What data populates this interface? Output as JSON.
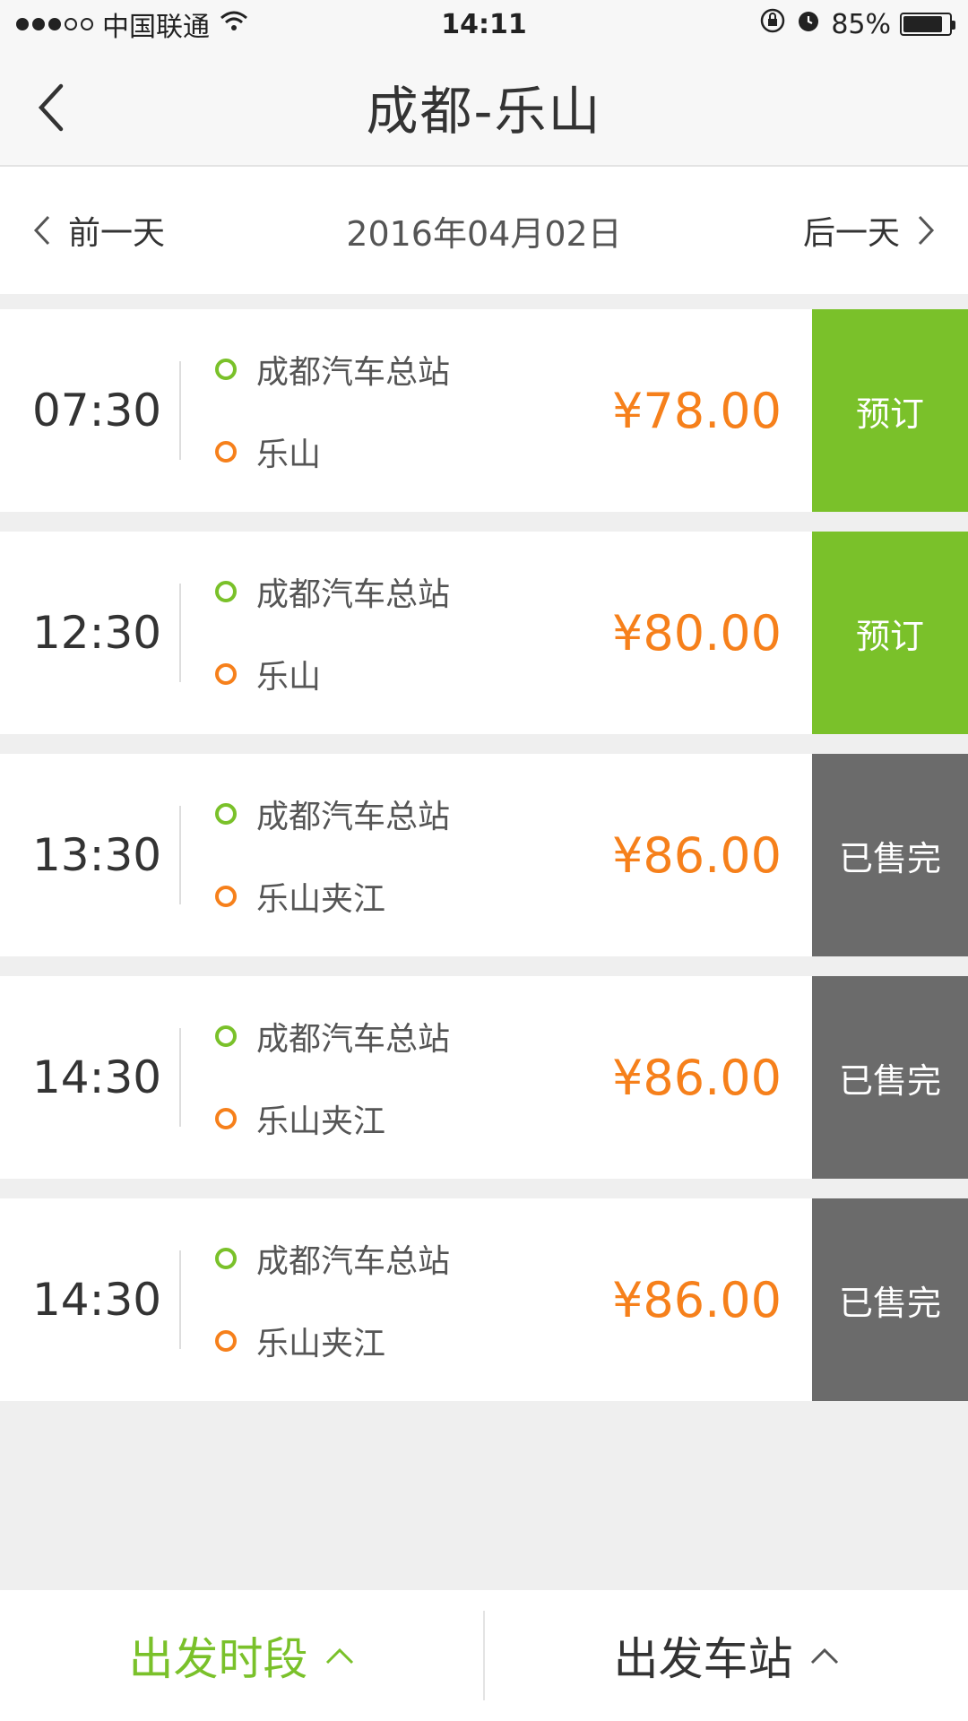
{
  "status_bar": {
    "carrier": "中国联通",
    "time": "14:11",
    "battery": "85%",
    "battery_level": 0.85
  },
  "nav": {
    "title": "成都-乐山"
  },
  "date_bar": {
    "prev_label": "前一天",
    "current_date": "2016年04月02日",
    "next_label": "后一天"
  },
  "trips": [
    {
      "time": "07:30",
      "from": "成都汽车总站",
      "to": "乐山",
      "price": "¥78.00",
      "action": "预订",
      "status": "book"
    },
    {
      "time": "12:30",
      "from": "成都汽车总站",
      "to": "乐山",
      "price": "¥80.00",
      "action": "预订",
      "status": "book"
    },
    {
      "time": "13:30",
      "from": "成都汽车总站",
      "to": "乐山夹江",
      "price": "¥86.00",
      "action": "已售完",
      "status": "soldout"
    },
    {
      "time": "14:30",
      "from": "成都汽车总站",
      "to": "乐山夹江",
      "price": "¥86.00",
      "action": "已售完",
      "status": "soldout"
    },
    {
      "time": "14:30",
      "from": "成都汽车总站",
      "to": "乐山夹江",
      "price": "¥86.00",
      "action": "已售完",
      "status": "soldout"
    }
  ],
  "bottom_tabs": {
    "departure_time": "出发时段",
    "departure_station": "出发车站"
  },
  "colors": {
    "green": "#7ac12a",
    "orange": "#f6801b",
    "soldout_gray": "#6b6b6b"
  }
}
